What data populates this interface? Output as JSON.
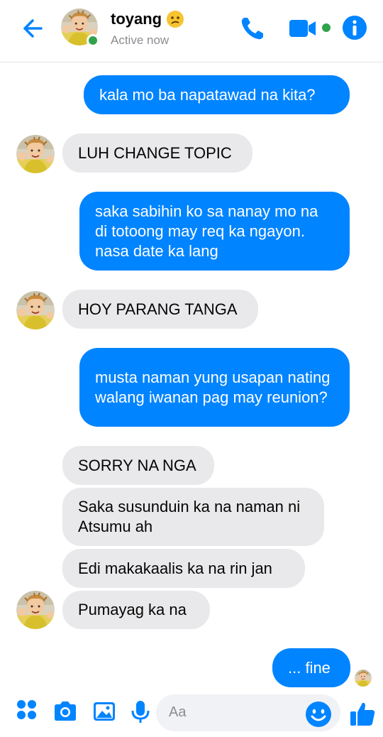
{
  "header": {
    "contact_name": "toyang",
    "status": "Active now"
  },
  "messages": [
    {
      "side": "out",
      "text": "kala mo ba napatawad na kita?"
    },
    {
      "side": "in",
      "text": "LUH CHANGE TOPIC"
    },
    {
      "side": "out",
      "text": "saka sabihin ko sa nanay mo na di totoong may req ka ngayon. nasa date ka lang"
    },
    {
      "side": "in",
      "text": "HOY PARANG TANGA"
    },
    {
      "side": "out",
      "text": "musta naman yung usapan nating walang iwanan pag may reunion?"
    },
    {
      "side": "in",
      "text": "SORRY NA NGA"
    },
    {
      "side": "in",
      "text": "Saka susunduin ka na naman ni Atsumu ah"
    },
    {
      "side": "in",
      "text": "Edi makakaalis ka na rin jan"
    },
    {
      "side": "in",
      "text": "Pumayag ka na"
    },
    {
      "side": "out",
      "text": "... fine"
    }
  ],
  "composer": {
    "placeholder": "Aa"
  },
  "icons": {
    "back": "back-arrow-icon",
    "call": "phone-icon",
    "video": "video-camera-icon",
    "info": "info-icon",
    "apps": "four-dots-icon",
    "camera": "camera-icon",
    "gallery": "image-icon",
    "mic": "microphone-icon",
    "emoji": "smiley-icon",
    "like": "thumbs-up-icon"
  },
  "colors": {
    "accent": "#0084ff",
    "incoming_bubble": "#e9e9eb",
    "online": "#31a24c"
  }
}
